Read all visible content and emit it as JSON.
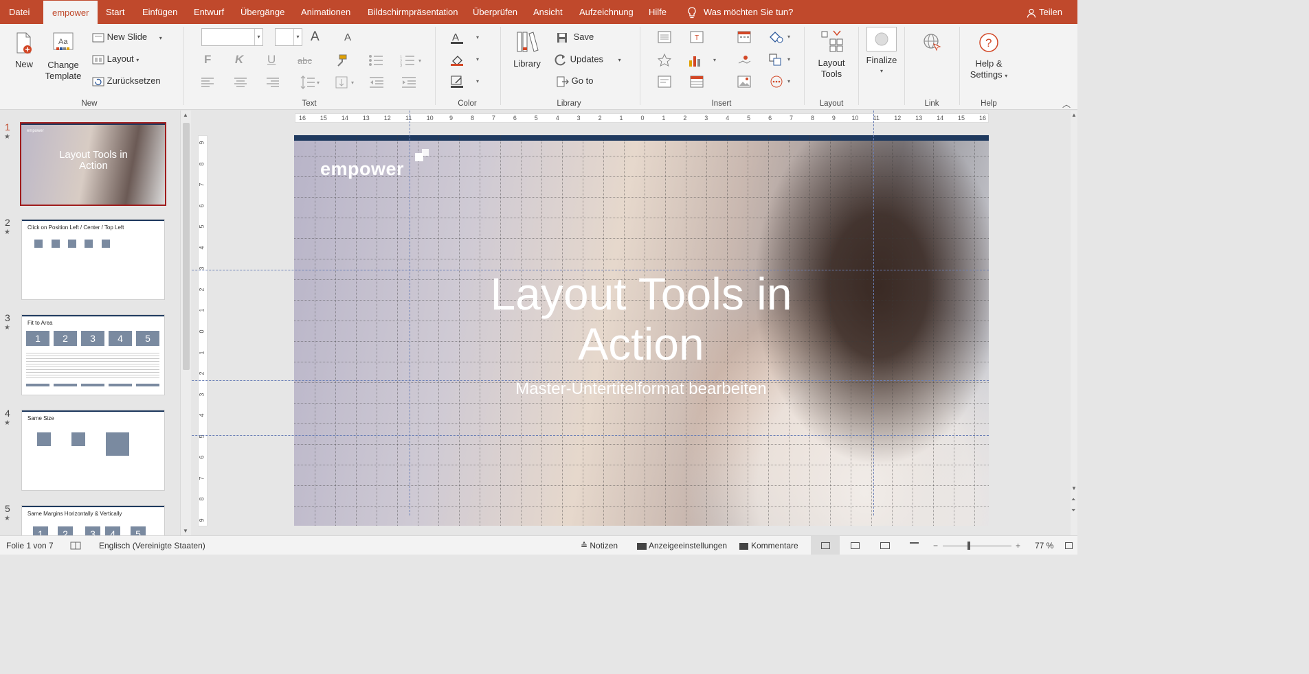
{
  "tabs": {
    "file": "Datei",
    "empower": "empower",
    "start": "Start",
    "insert": "Einfügen",
    "design": "Entwurf",
    "transitions": "Übergänge",
    "animations": "Animationen",
    "slideshow": "Bildschirmpräsentation",
    "review": "Überprüfen",
    "view": "Ansicht",
    "recording": "Aufzeichnung",
    "help": "Hilfe",
    "tellme": "Was möchten Sie tun?",
    "share": "Teilen"
  },
  "ribbon": {
    "new_group": {
      "label": "New",
      "new": "New",
      "change_template_1": "Change",
      "change_template_2": "Template",
      "new_slide": "New Slide",
      "layout": "Layout",
      "reset": "Zurücksetzen"
    },
    "text_group": {
      "label": "Text",
      "bold": "F",
      "italic": "K",
      "underline": "U",
      "strike": "abc",
      "grow": "A",
      "shrink": "A"
    },
    "color_group": {
      "label": "Color"
    },
    "library_group": {
      "label": "Library",
      "library": "Library",
      "save": "Save",
      "updates": "Updates",
      "goto": "Go to"
    },
    "insert_group": {
      "label": "Insert"
    },
    "layout_group": {
      "label": "Layout",
      "layout_tools_1": "Layout",
      "layout_tools_2": "Tools"
    },
    "finalize": "Finalize",
    "link_group": {
      "label": "Link"
    },
    "help_group": {
      "label": "Help",
      "help_1": "Help &",
      "help_2": "Settings"
    }
  },
  "thumbnails": [
    {
      "num": "1",
      "title": "Layout Tools in Action",
      "logo": "empower"
    },
    {
      "num": "2",
      "title": "Click on Position Left / Center / Top Left"
    },
    {
      "num": "3",
      "title": "Fit to Area",
      "boxes": [
        "1",
        "2",
        "3",
        "4",
        "5"
      ]
    },
    {
      "num": "4",
      "title": "Same Size"
    },
    {
      "num": "5",
      "title": "Same Margins Horizontally & Vertically",
      "boxes": [
        "1",
        "2",
        "3",
        "4",
        "5"
      ]
    }
  ],
  "ruler": {
    "h_ticks": [
      "16",
      "15",
      "14",
      "13",
      "12",
      "11",
      "10",
      "9",
      "8",
      "7",
      "6",
      "5",
      "4",
      "3",
      "2",
      "1",
      "0",
      "1",
      "2",
      "3",
      "4",
      "5",
      "6",
      "7",
      "8",
      "9",
      "10",
      "11",
      "12",
      "13",
      "14",
      "15",
      "16"
    ],
    "v_ticks": [
      "9",
      "8",
      "7",
      "6",
      "5",
      "4",
      "3",
      "2",
      "1",
      "0",
      "1",
      "2",
      "3",
      "4",
      "5",
      "6",
      "7",
      "8",
      "9"
    ]
  },
  "slide": {
    "logo": "empower",
    "title_line1": "Layout Tools in",
    "title_line2": "Action",
    "subtitle": "Master-Untertitelformat bearbeiten"
  },
  "status": {
    "slide_of": "Folie 1 von 7",
    "language": "Englisch (Vereinigte Staaten)",
    "notes": "Notizen",
    "display": "Anzeigeeinstellungen",
    "comments": "Kommentare",
    "zoom": "77 %"
  },
  "colors": {
    "accent": "#c0492c",
    "slide_bar": "#1f3a5f",
    "thumb_box": "#7a8aa0",
    "selected_thumb": "#a01c1c"
  }
}
